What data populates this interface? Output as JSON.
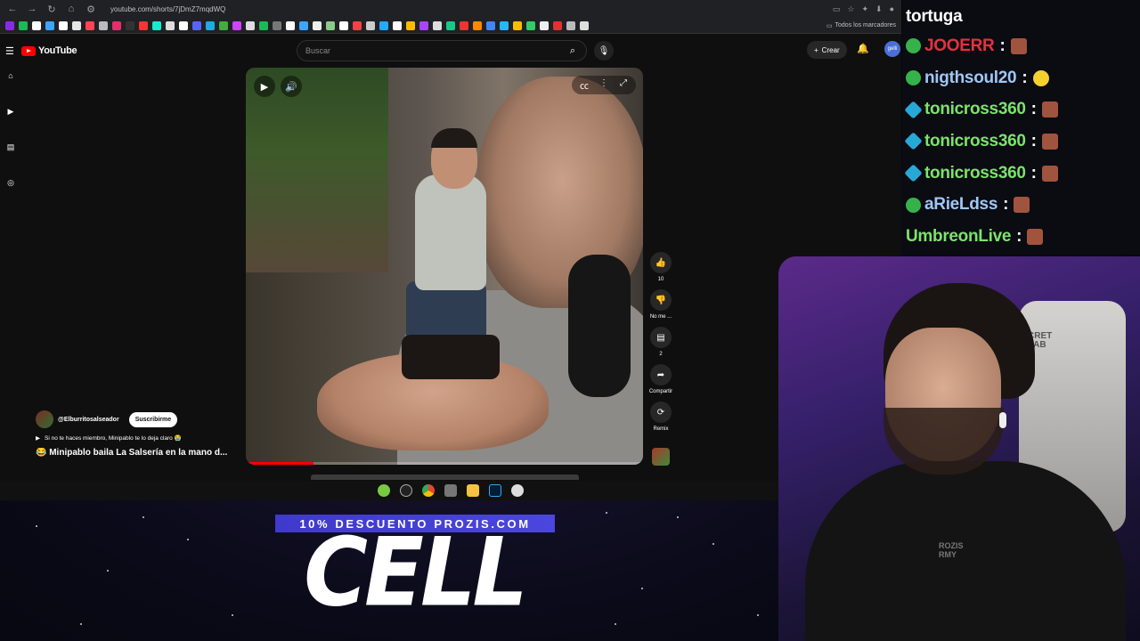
{
  "browser": {
    "url": "youtube.com/shorts/7jDmZ7mqdWQ",
    "bookmarks_folder": "Todos los marcadores"
  },
  "youtube": {
    "logo_text": "YouTube",
    "search_placeholder": "Buscar",
    "create_label": "Crear",
    "avatar_text": "gelli"
  },
  "video": {
    "progress_fraction": 0.17,
    "actions": [
      {
        "icon": "thumbs-up-icon",
        "label": "10"
      },
      {
        "icon": "thumbs-down-icon",
        "label": "No me ..."
      },
      {
        "icon": "comments-icon",
        "label": "2"
      },
      {
        "icon": "share-icon",
        "label": "Compartir"
      },
      {
        "icon": "remix-icon",
        "label": "Remix"
      }
    ],
    "channel": "@Elburritosalseador",
    "subscribe_label": "Suscribirme",
    "description": "Si no te haces miembro, Minipablo te lo deja claro 😭",
    "title": "😂 Minipablo baila La Salsería en la mano d..."
  },
  "chat": {
    "streamer": "tortuga",
    "messages": [
      {
        "user": "JOOERR",
        "color": "#e5313f",
        "badge": "green"
      },
      {
        "user": "nigthsoul20",
        "color": "#9ec8f5",
        "badge": "green"
      },
      {
        "user": "tonicross360",
        "color": "#7be36b",
        "badge": "cube"
      },
      {
        "user": "tonicross360",
        "color": "#7be36b",
        "badge": "cube"
      },
      {
        "user": "tonicross360",
        "color": "#7be36b",
        "badge": "cube"
      },
      {
        "user": "aRieLdss",
        "color": "#9ec8f5",
        "badge": "green"
      },
      {
        "user": "UmbreonLive",
        "color": "#7be36b",
        "badge": "none"
      }
    ]
  },
  "promo": {
    "discount": "10% DESCUENTO PROZIS.COM",
    "big_text": "CELL"
  },
  "webcam": {
    "chair_text_1": "CRET",
    "chair_text_2": "LAB",
    "shirt_text_1": "ROZIS",
    "shirt_text_2": "RMY"
  }
}
